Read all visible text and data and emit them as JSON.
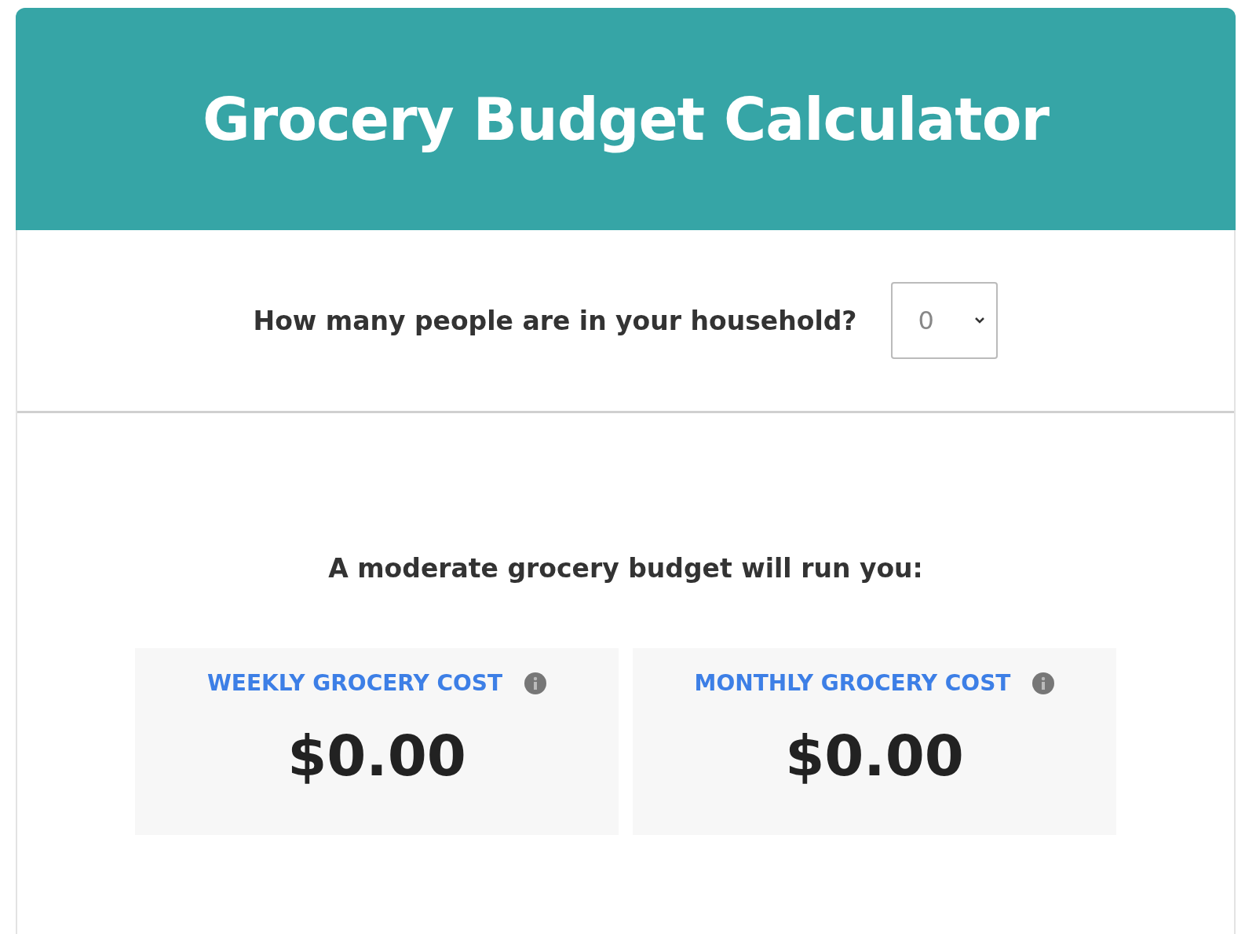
{
  "header": {
    "title": "Grocery Budget Calculator"
  },
  "question": {
    "label": "How many people are in your household?",
    "value": "0"
  },
  "result": {
    "intro": "A moderate grocery budget will run you:",
    "cards": [
      {
        "label": "WEEKLY GROCERY COST",
        "value": "$0.00"
      },
      {
        "label": "MONTHLY GROCERY COST",
        "value": "$0.00"
      }
    ]
  }
}
